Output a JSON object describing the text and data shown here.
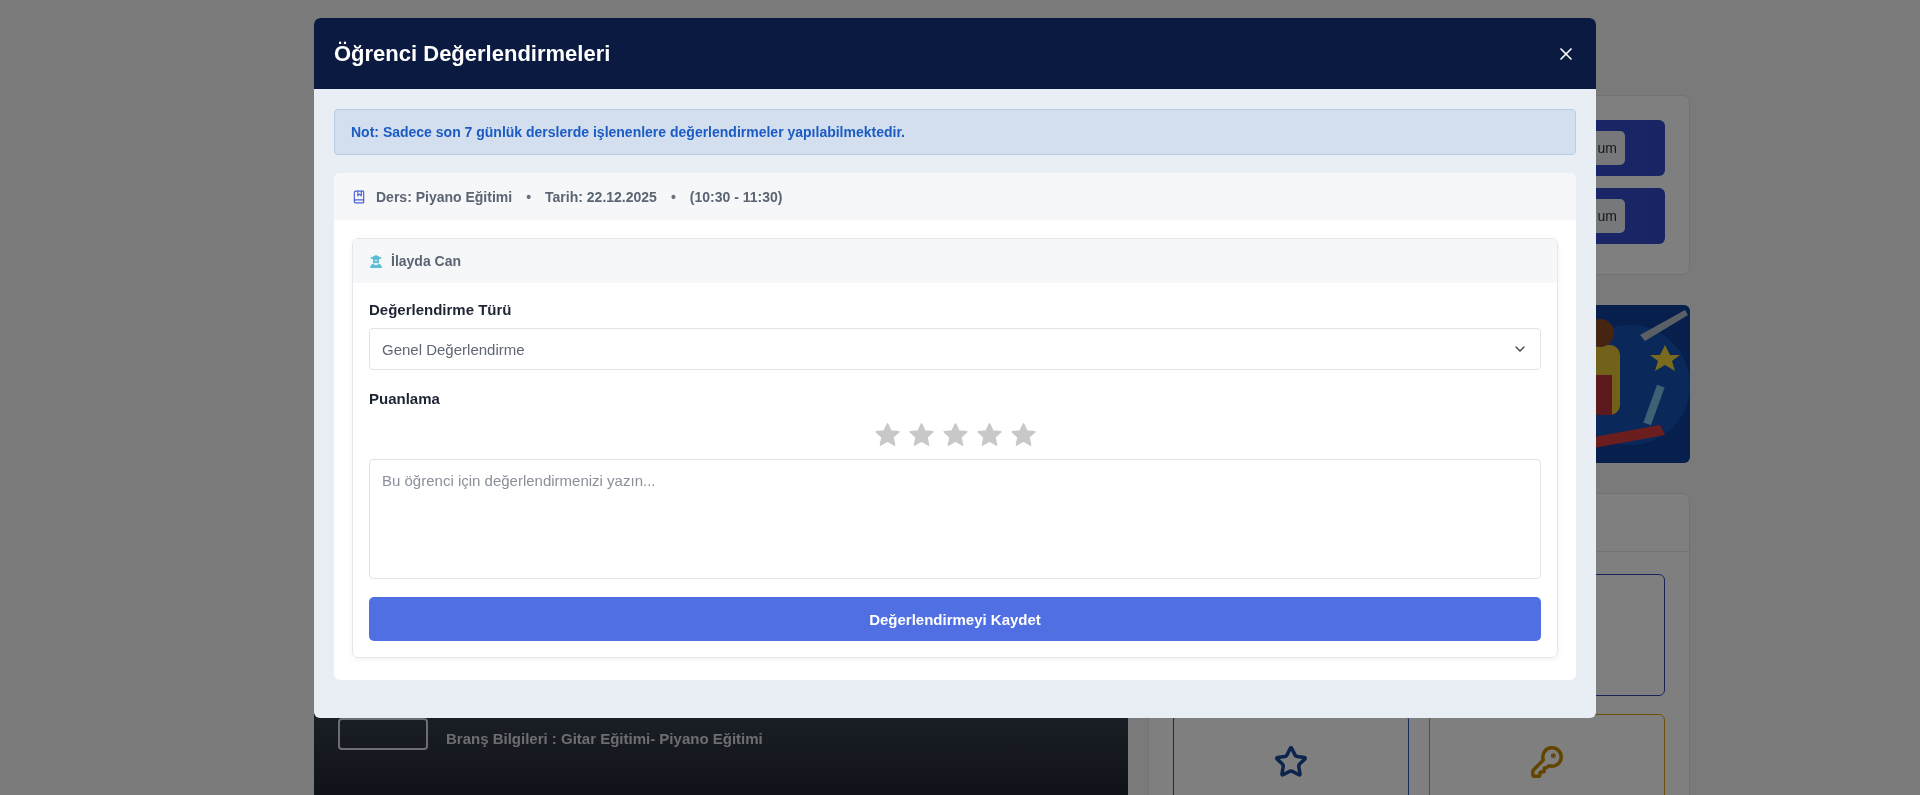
{
  "background": {
    "action_buttons": [
      "um",
      "um"
    ],
    "branch_info": "Branş Bilgileri : Gitar Eğitimi- Piyano Eğitimi"
  },
  "modal": {
    "title": "Öğrenci Değerlendirmeleri",
    "note": "Not: Sadece son 7 günlük derslerde işlenenlere değerlendirmeler yapılabilmektedir.",
    "lesson": {
      "details": [
        {
          "kind": "text",
          "text": "Ders: Piyano Eğitimi"
        },
        {
          "kind": "separator",
          "text": "•"
        },
        {
          "kind": "text",
          "text": "Tarih: 22.12.2025"
        },
        {
          "kind": "separator",
          "text": "•"
        },
        {
          "kind": "text",
          "text": "(10:30 - 11:30)"
        }
      ]
    },
    "student": {
      "name": "İlayda Can",
      "type_label": "Değerlendirme Türü",
      "type_value": "Genel Değerlendirme",
      "rating_label": "Puanlama",
      "stars": 0,
      "comment_placeholder": "Bu öğrenci için değerlendirmenizi yazın...",
      "save_button": "Değerlendirmeyi Kaydet"
    }
  }
}
